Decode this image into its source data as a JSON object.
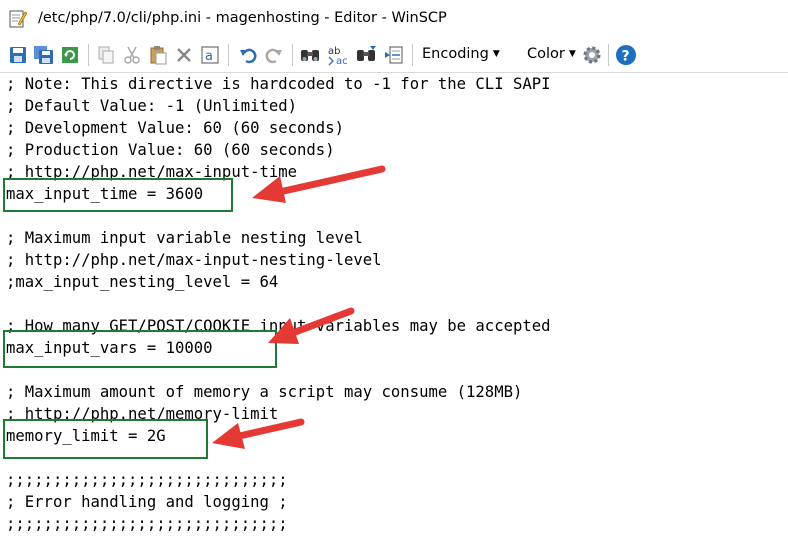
{
  "window": {
    "title": "/etc/php/7.0/cli/php.ini - magenhosting - Editor - WinSCP"
  },
  "toolbar": {
    "icons": [
      "save-icon",
      "save-all-icon",
      "reload-icon",
      "copy-icon",
      "cut-icon",
      "paste-icon",
      "delete-icon",
      "select-all-icon",
      "undo-icon",
      "redo-icon",
      "find-icon",
      "replace-icon",
      "find-next-icon",
      "go-to-line-icon",
      "settings-icon",
      "help-icon"
    ],
    "encoding_label": "Encoding",
    "color_label": "Color",
    "accent_color": "#1e6fc0"
  },
  "editor": {
    "lines": [
      "; Note: This directive is hardcoded to -1 for the CLI SAPI",
      "; Default Value: -1 (Unlimited)",
      "; Development Value: 60 (60 seconds)",
      "; Production Value: 60 (60 seconds)",
      "; http://php.net/max-input-time",
      "max_input_time = 3600",
      "",
      "; Maximum input variable nesting level",
      "; http://php.net/max-input-nesting-level",
      ";max_input_nesting_level = 64",
      "",
      "; How many GET/POST/COOKIE input variables may be accepted",
      "max_input_vars = 10000",
      "",
      "; Maximum amount of memory a script may consume (128MB)",
      "; http://php.net/memory-limit",
      "memory_limit = 2G",
      "",
      ";;;;;;;;;;;;;;;;;;;;;;;;;;;;;;",
      "; Error handling and logging ;",
      ";;;;;;;;;;;;;;;;;;;;;;;;;;;;;;"
    ]
  },
  "annotations": {
    "highlight_color": "#1e7a34",
    "arrow_color": "#e53935"
  }
}
